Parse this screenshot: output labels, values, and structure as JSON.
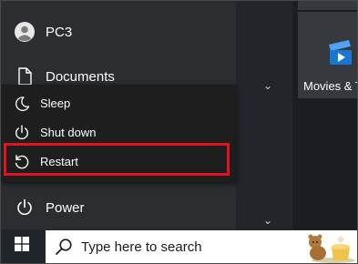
{
  "user": {
    "name": "PC3"
  },
  "nav": {
    "documents": "Documents",
    "power": "Power"
  },
  "power_menu": {
    "items": [
      {
        "label": "Sleep",
        "icon": "moon-icon"
      },
      {
        "label": "Shut down",
        "icon": "power-icon"
      },
      {
        "label": "Restart",
        "icon": "restart-icon"
      }
    ],
    "highlighted": "Restart",
    "highlight_color": "#e0141e"
  },
  "tiles": {
    "movies": "Movies & T"
  },
  "taskbar": {
    "search_placeholder": "Type here to search"
  },
  "colors": {
    "menu_bg": "#2b2d31",
    "flyout_bg": "#1e1e1f",
    "taskbar_bg": "#20252b"
  }
}
